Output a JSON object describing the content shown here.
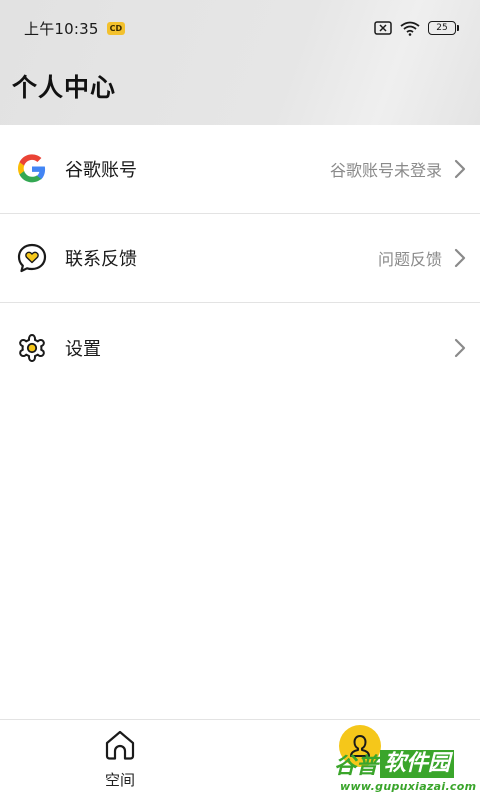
{
  "status_bar": {
    "time": "上午10:35",
    "badge": "CD",
    "battery": "25"
  },
  "header": {
    "title": "个人中心"
  },
  "menu": [
    {
      "label": "谷歌账号",
      "value": "谷歌账号未登录",
      "icon": "google-icon"
    },
    {
      "label": "联系反馈",
      "value": "问题反馈",
      "icon": "feedback-icon"
    },
    {
      "label": "设置",
      "value": "",
      "icon": "settings-icon"
    }
  ],
  "bottom_nav": {
    "space_label": "空间",
    "me_icon": "user-icon"
  },
  "watermark": {
    "brand_part1": "谷普",
    "brand_part2": "软件园",
    "url": "www.gupuxiazai.com"
  },
  "colors": {
    "accent": "#f5c71a",
    "watermark": "#3aa52b"
  }
}
